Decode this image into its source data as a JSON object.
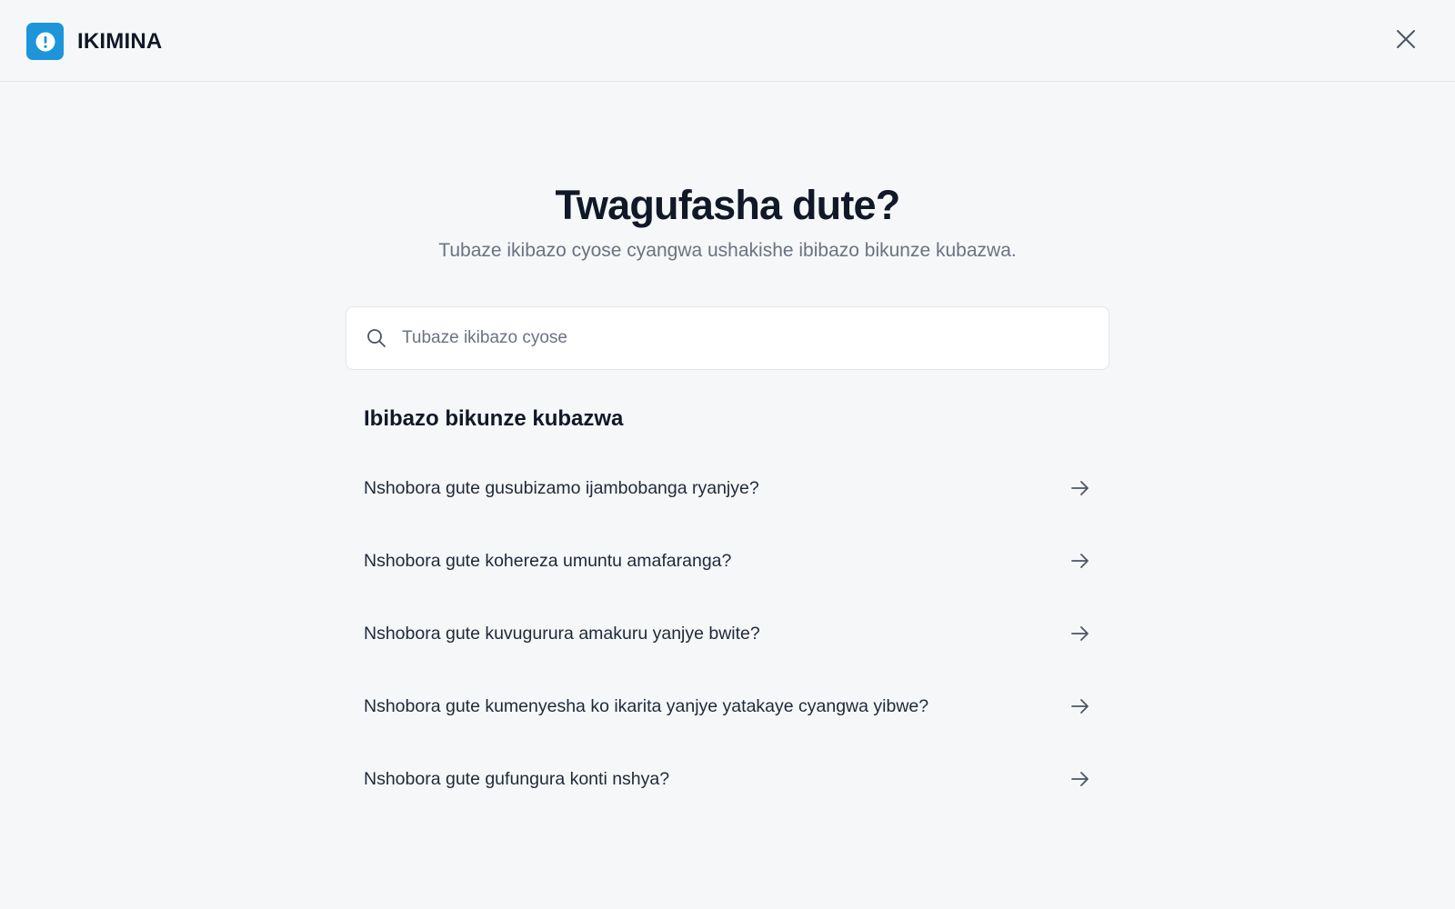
{
  "header": {
    "brand_name": "IKIMINA",
    "logo_icon": "alert-circle-icon",
    "close_icon": "close-icon",
    "accent_color": "#1d95d9"
  },
  "hero": {
    "title": "Twagufasha dute?",
    "subtitle": "Tubaze ikibazo cyose cyangwa ushakishe ibibazo bikunze kubazwa."
  },
  "search": {
    "placeholder": "Tubaze ikibazo cyose",
    "value": "",
    "icon": "search-icon"
  },
  "faq": {
    "heading": "Ibibazo bikunze kubazwa",
    "items": [
      {
        "question": "Nshobora gute gusubizamo ijambobanga ryanjye?",
        "icon": "arrow-right-icon"
      },
      {
        "question": "Nshobora gute kohereza umuntu amafaranga?",
        "icon": "arrow-right-icon"
      },
      {
        "question": "Nshobora gute kuvugurura amakuru yanjye bwite?",
        "icon": "arrow-right-icon"
      },
      {
        "question": "Nshobora gute kumenyesha ko ikarita yanjye yatakaye cyangwa yibwe?",
        "icon": "arrow-right-icon"
      },
      {
        "question": "Nshobora gute gufungura konti nshya?",
        "icon": "arrow-right-icon"
      }
    ]
  }
}
